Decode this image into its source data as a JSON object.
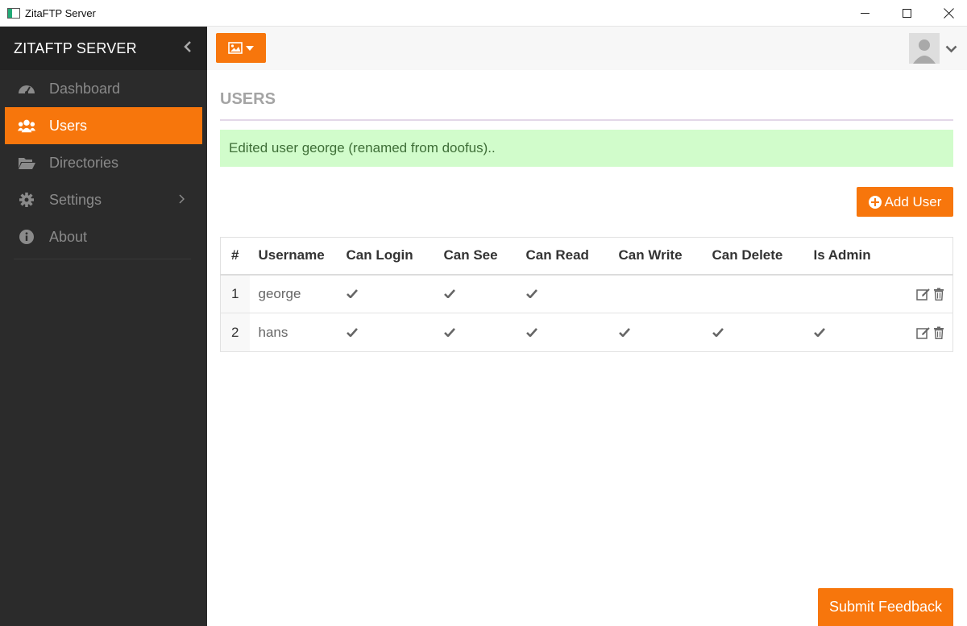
{
  "window": {
    "title": "ZitaFTP Server"
  },
  "sidebar": {
    "brand": "ZITAFTP SERVER",
    "items": [
      {
        "label": "Dashboard",
        "icon": "dashboard-icon"
      },
      {
        "label": "Users",
        "icon": "users-icon",
        "active": true
      },
      {
        "label": "Directories",
        "icon": "folder-icon"
      },
      {
        "label": "Settings",
        "icon": "gear-icon",
        "has_submenu": true
      },
      {
        "label": "About",
        "icon": "info-icon"
      }
    ]
  },
  "page": {
    "title": "USERS",
    "alert": "Edited user george (renamed from doofus).."
  },
  "toolbar": {
    "add_user_label": "Add User"
  },
  "table": {
    "headers": [
      "#",
      "Username",
      "Can Login",
      "Can See",
      "Can Read",
      "Can Write",
      "Can Delete",
      "Is Admin"
    ],
    "rows": [
      {
        "num": "1",
        "username": "george",
        "can_login": true,
        "can_see": true,
        "can_read": true,
        "can_write": false,
        "can_delete": false,
        "is_admin": false
      },
      {
        "num": "2",
        "username": "hans",
        "can_login": true,
        "can_see": true,
        "can_read": true,
        "can_write": true,
        "can_delete": true,
        "is_admin": true
      }
    ]
  },
  "feedback": {
    "label": "Submit Feedback"
  },
  "colors": {
    "accent": "#f7760c",
    "sidebar_bg": "#2b2b2b",
    "alert_bg": "#d1fccb"
  }
}
